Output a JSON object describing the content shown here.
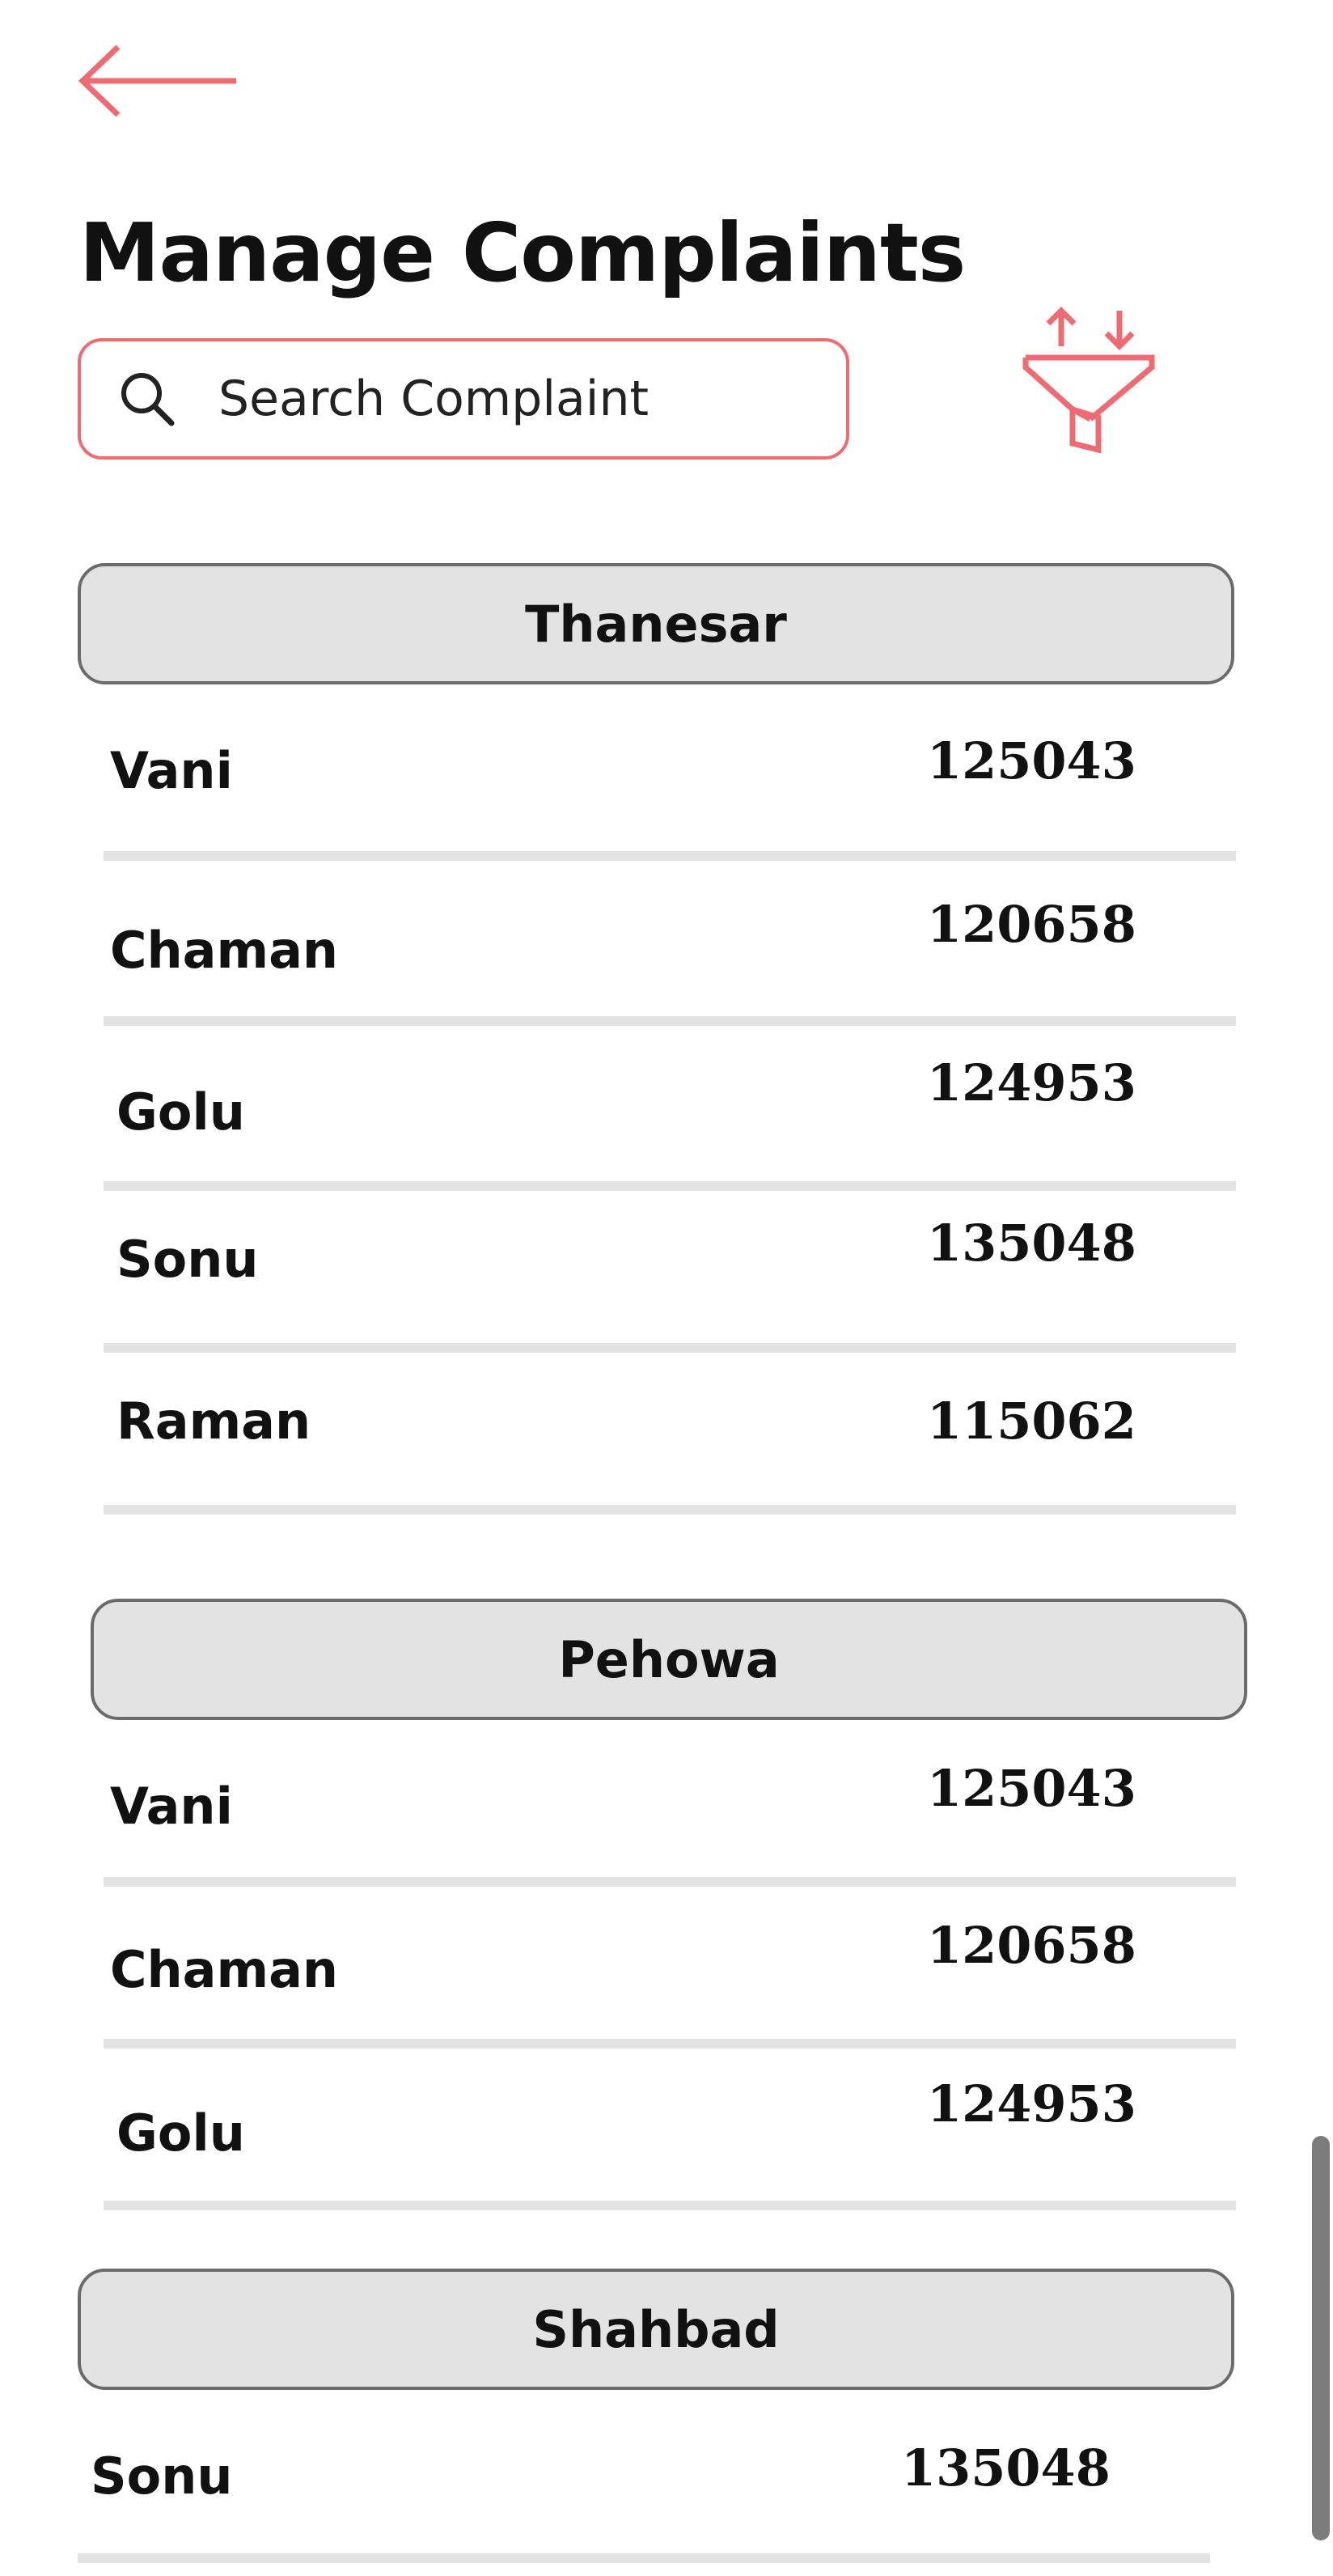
{
  "header": {
    "back_icon": "arrow-left-icon",
    "title": "Manage Complaints"
  },
  "search": {
    "icon": "search-icon",
    "placeholder": "Search Complaint",
    "value": ""
  },
  "filter": {
    "icon": "funnel-sort-icon"
  },
  "colors": {
    "accent": "#ef6b73",
    "header_bg": "#e3e3e3",
    "header_border": "#6b6b6b",
    "divider": "#e3e3e3",
    "scrollbar": "#7c7c7c"
  },
  "groups": [
    {
      "name": "Thanesar",
      "items": [
        {
          "name": "Vani",
          "number": "125043"
        },
        {
          "name": "Chaman",
          "number": "120658"
        },
        {
          "name": "Golu",
          "number": "124953"
        },
        {
          "name": "Sonu",
          "number": "135048"
        },
        {
          "name": "Raman",
          "number": "115062"
        }
      ]
    },
    {
      "name": "Pehowa",
      "items": [
        {
          "name": "Vani",
          "number": "125043"
        },
        {
          "name": "Chaman",
          "number": "120658"
        },
        {
          "name": "Golu",
          "number": "124953"
        }
      ]
    },
    {
      "name": "Shahbad",
      "items": [
        {
          "name": "Sonu",
          "number": "135048"
        }
      ]
    }
  ]
}
